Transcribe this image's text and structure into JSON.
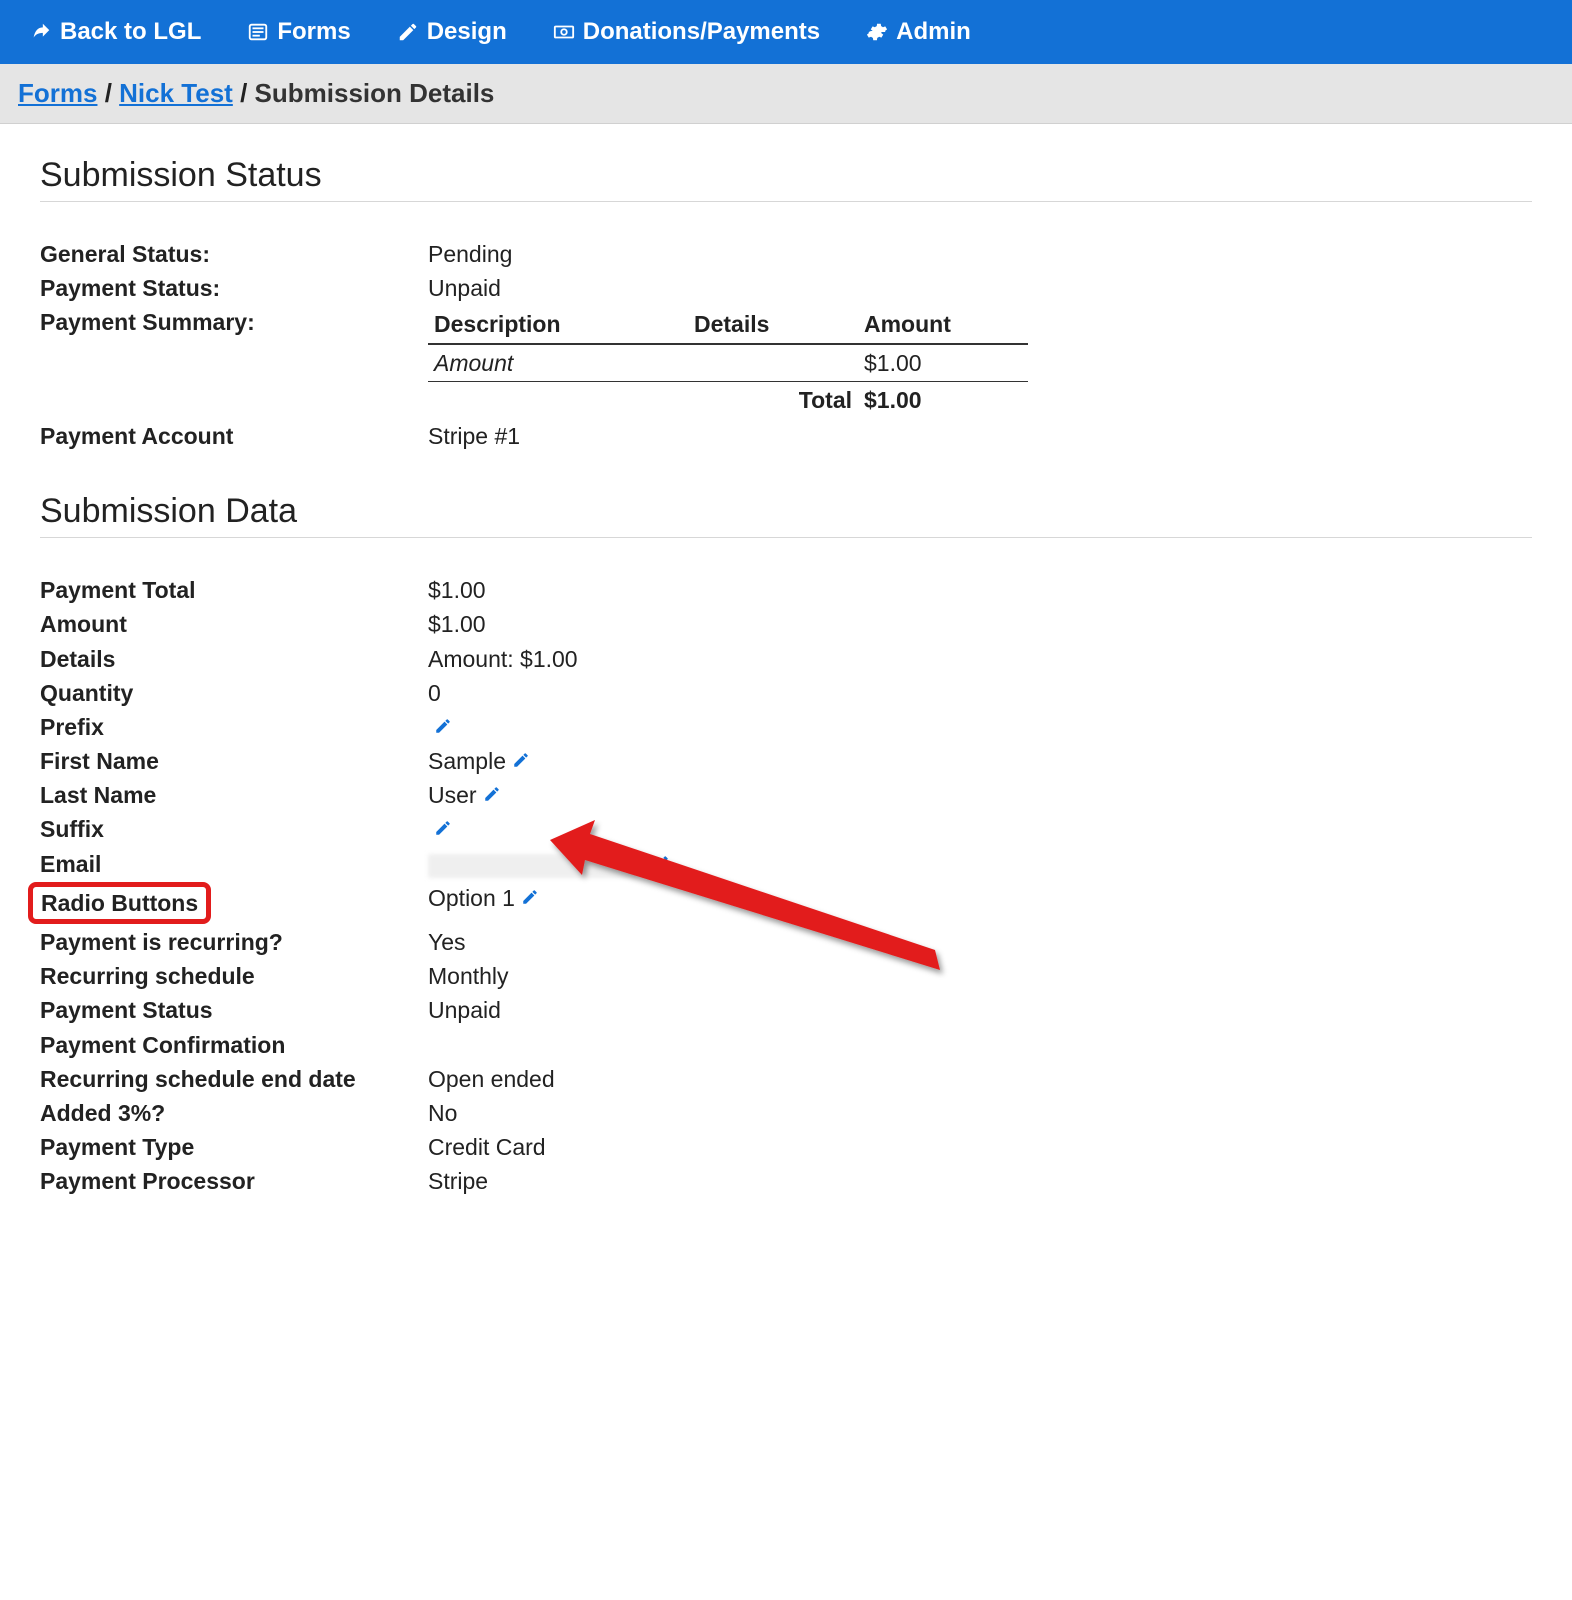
{
  "nav": {
    "back": "Back to LGL",
    "forms": "Forms",
    "design": "Design",
    "donations": "Donations/Payments",
    "admin": "Admin"
  },
  "breadcrumb": {
    "forms": "Forms",
    "form_name": "Nick Test",
    "current": "Submission Details"
  },
  "status_section": {
    "title": "Submission Status",
    "general_status_label": "General Status:",
    "general_status": "Pending",
    "payment_status_label": "Payment Status:",
    "payment_status": "Unpaid",
    "payment_summary_label": "Payment Summary:",
    "summary": {
      "head_desc": "Description",
      "head_details": "Details",
      "head_amount": "Amount",
      "row_desc": "Amount",
      "row_amount": "$1.00",
      "total_label": "Total",
      "total_amount": "$1.00"
    },
    "payment_account_label": "Payment Account",
    "payment_account": "Stripe #1"
  },
  "data_section": {
    "title": "Submission Data",
    "rows": {
      "payment_total": {
        "label": "Payment Total",
        "value": "$1.00"
      },
      "amount": {
        "label": "Amount",
        "value": "$1.00"
      },
      "details": {
        "label": "Details",
        "value": "Amount: $1.00"
      },
      "quantity": {
        "label": "Quantity",
        "value": "0"
      },
      "prefix": {
        "label": "Prefix",
        "value": ""
      },
      "first_name": {
        "label": "First Name",
        "value": "Sample"
      },
      "last_name": {
        "label": "Last Name",
        "value": "User"
      },
      "suffix": {
        "label": "Suffix",
        "value": ""
      },
      "email": {
        "label": "Email",
        "value": ""
      },
      "radio_buttons": {
        "label": "Radio Buttons",
        "value": "Option 1"
      },
      "recurring": {
        "label": "Payment is recurring?",
        "value": "Yes"
      },
      "schedule": {
        "label": "Recurring schedule",
        "value": "Monthly"
      },
      "pay_status": {
        "label": "Payment Status",
        "value": "Unpaid"
      },
      "confirmation": {
        "label": "Payment Confirmation",
        "value": ""
      },
      "end_date": {
        "label": "Recurring schedule end date",
        "value": "Open ended"
      },
      "added_3": {
        "label": "Added 3%?",
        "value": "No"
      },
      "pay_type": {
        "label": "Payment Type",
        "value": "Credit Card"
      },
      "processor": {
        "label": "Payment Processor",
        "value": "Stripe"
      }
    }
  }
}
